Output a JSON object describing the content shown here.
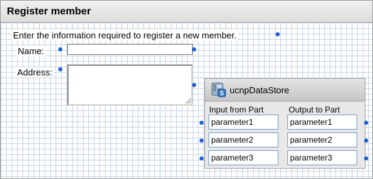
{
  "header": {
    "title": "Register member"
  },
  "form": {
    "intro": "Enter the information required to register a new member.",
    "name_label": "Name:",
    "address_label": "Address:",
    "name_value": "",
    "address_value": ""
  },
  "part": {
    "title": "ucnpDataStore",
    "input_heading": "Input from Part",
    "output_heading": "Output to Part",
    "inputs": [
      "parameter1",
      "parameter2",
      "parameter3"
    ],
    "outputs": [
      "parameter1",
      "parameter2",
      "parameter3"
    ]
  },
  "colors": {
    "handle": "#1a5fd4",
    "grid": "#c8d4e4",
    "field_border": "#7d9ec0"
  }
}
